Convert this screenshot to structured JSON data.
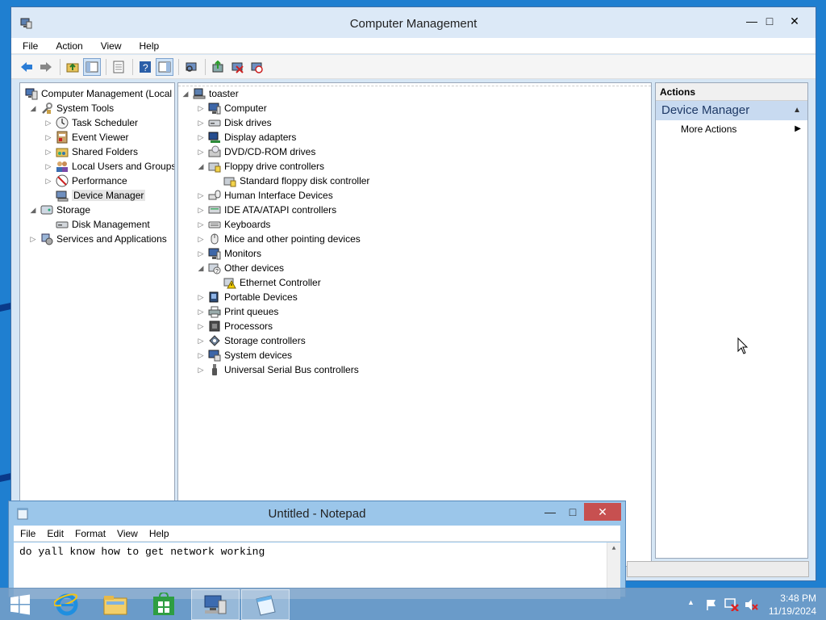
{
  "computer_management": {
    "title": "Computer Management",
    "menu": [
      "File",
      "Action",
      "View",
      "Help"
    ],
    "left_tree": [
      {
        "label": "Computer Management (Local",
        "expander": "",
        "icon": "computer-management-icon",
        "level": 0
      },
      {
        "label": "System Tools",
        "expander": "◢",
        "icon": "tools-icon",
        "level": 1
      },
      {
        "label": "Task Scheduler",
        "expander": "▷",
        "icon": "clock-icon",
        "level": 2
      },
      {
        "label": "Event Viewer",
        "expander": "▷",
        "icon": "event-viewer-icon",
        "level": 2
      },
      {
        "label": "Shared Folders",
        "expander": "▷",
        "icon": "shared-folder-icon",
        "level": 2
      },
      {
        "label": "Local Users and Groups",
        "expander": "▷",
        "icon": "users-icon",
        "level": 2
      },
      {
        "label": "Performance",
        "expander": "▷",
        "icon": "performance-icon",
        "level": 2
      },
      {
        "label": "Device Manager",
        "expander": "",
        "icon": "device-manager-icon",
        "level": 2,
        "selected": true
      },
      {
        "label": "Storage",
        "expander": "◢",
        "icon": "storage-icon",
        "level": 1
      },
      {
        "label": "Disk Management",
        "expander": "",
        "icon": "disk-icon",
        "level": 2
      },
      {
        "label": "Services and Applications",
        "expander": "▷",
        "icon": "services-icon",
        "level": 1
      }
    ],
    "device_tree": [
      {
        "label": "toaster",
        "expander": "◢",
        "icon": "computer-icon",
        "level": 0
      },
      {
        "label": "Computer",
        "expander": "▷",
        "icon": "monitor-icon",
        "level": 1
      },
      {
        "label": "Disk drives",
        "expander": "▷",
        "icon": "disk-icon",
        "level": 1
      },
      {
        "label": "Display adapters",
        "expander": "▷",
        "icon": "display-adapter-icon",
        "level": 1
      },
      {
        "label": "DVD/CD-ROM drives",
        "expander": "▷",
        "icon": "dvd-icon",
        "level": 1
      },
      {
        "label": "Floppy drive controllers",
        "expander": "◢",
        "icon": "floppy-controller-icon",
        "level": 1
      },
      {
        "label": "Standard floppy disk controller",
        "expander": "",
        "icon": "floppy-controller-icon",
        "level": 2
      },
      {
        "label": "Human Interface Devices",
        "expander": "▷",
        "icon": "hid-icon",
        "level": 1
      },
      {
        "label": "IDE ATA/ATAPI controllers",
        "expander": "▷",
        "icon": "ide-icon",
        "level": 1
      },
      {
        "label": "Keyboards",
        "expander": "▷",
        "icon": "keyboard-icon",
        "level": 1
      },
      {
        "label": "Mice and other pointing devices",
        "expander": "▷",
        "icon": "mouse-icon",
        "level": 1
      },
      {
        "label": "Monitors",
        "expander": "▷",
        "icon": "monitor-icon",
        "level": 1
      },
      {
        "label": "Other devices",
        "expander": "◢",
        "icon": "other-devices-icon",
        "level": 1
      },
      {
        "label": "Ethernet Controller",
        "expander": "",
        "icon": "warning-device-icon",
        "level": 2
      },
      {
        "label": "Portable Devices",
        "expander": "▷",
        "icon": "portable-device-icon",
        "level": 1
      },
      {
        "label": "Print queues",
        "expander": "▷",
        "icon": "printer-icon",
        "level": 1
      },
      {
        "label": "Processors",
        "expander": "▷",
        "icon": "processor-icon",
        "level": 1
      },
      {
        "label": "Storage controllers",
        "expander": "▷",
        "icon": "storage-controller-icon",
        "level": 1
      },
      {
        "label": "System devices",
        "expander": "▷",
        "icon": "system-devices-icon",
        "level": 1
      },
      {
        "label": "Universal Serial Bus controllers",
        "expander": "▷",
        "icon": "usb-icon",
        "level": 1
      }
    ],
    "actions": {
      "header": "Actions",
      "section": "Device Manager",
      "more": "More Actions"
    }
  },
  "notepad": {
    "title": "Untitled - Notepad",
    "menu": [
      "File",
      "Edit",
      "Format",
      "View",
      "Help"
    ],
    "content": "do yall know how to get network working"
  },
  "taskbar": {
    "time": "3:48 PM",
    "date": "11/19/2024",
    "apps": [
      "start-icon",
      "internet-explorer-icon",
      "file-explorer-icon",
      "store-icon",
      "computer-management-icon",
      "notepad-icon"
    ]
  }
}
